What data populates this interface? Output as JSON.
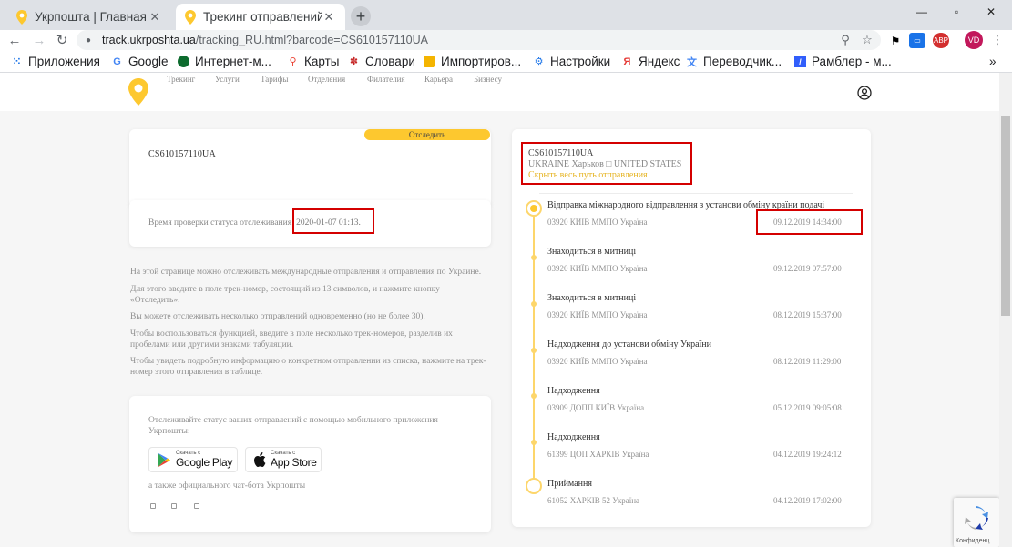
{
  "browser": {
    "tabs": [
      {
        "title": "Укрпошта | Главная п",
        "active": false
      },
      {
        "title": "Трекинг отправлений",
        "active": true
      }
    ],
    "url_host": "track.ukrposhta.ua",
    "url_path": "/tracking_RU.html?barcode=CS610157110UA",
    "avatar_initials": "VD",
    "bookmarks": [
      {
        "label": "Приложения",
        "icon": "apps-grid-icon",
        "color": "#1a73e8"
      },
      {
        "label": "Google",
        "icon": "google-icon",
        "color": "#4285f4"
      },
      {
        "label": "Интернет-м...",
        "icon": "shop-icon",
        "color": "#0d6b2e"
      },
      {
        "label": "Карты",
        "icon": "maps-pin-icon",
        "color": "#ea4335"
      },
      {
        "label": "Словари",
        "icon": "dictionary-icon",
        "color": "#c62828"
      },
      {
        "label": "Импортиров...",
        "icon": "folder-icon",
        "color": "#f4b400"
      },
      {
        "label": "Настройки",
        "icon": "gear-icon",
        "color": "#1a73e8"
      },
      {
        "label": "Яндекс",
        "icon": "yandex-icon",
        "color": "#e53935"
      },
      {
        "label": "Переводчик...",
        "icon": "translate-icon",
        "color": "#4285f4"
      },
      {
        "label": "Рамблер - м...",
        "icon": "rambler-icon",
        "color": "#315efb"
      }
    ],
    "more_bookmarks": "»"
  },
  "site": {
    "menu": [
      "Трекинг",
      "Услуги",
      "Тарифы",
      "Отделения",
      "Филателия",
      "Карьера",
      "Бизнесу"
    ],
    "accent_color": "#fdc82f"
  },
  "tracking": {
    "barcode": "CS610157110UA",
    "button_label": "Отследить",
    "time_label": "Время проверки статуса отслеживания:",
    "time_value": "2020-01-07 01:13."
  },
  "info": [
    "На этой странице можно отслеживать международные отправления и отправления по Украине.",
    "Для этого введите в поле трек-номер, состоящий из 13 символов, и нажмите кнопку «Отследить».",
    "Вы можете отслеживать несколько отправлений одновременно (но не более 30).",
    "Чтобы воспользоваться функцией, введите в поле несколько трек-номеров, разделив их пробелами или другими знаками табуляции.",
    "Чтобы увидеть подробную информацию о конкретном отправлении из списка, нажмите на трек-номер этого отправления в таблице."
  ],
  "app": {
    "text": "Отслеживайте статус ваших отправлений с помощью мобильного приложения Укрпошты:",
    "google_small": "Скачать с",
    "google_big": "Google Play",
    "apple_small": "Скачать с",
    "apple_big": "App Store",
    "bot_text": "а также официального чат-бота Укрпошты"
  },
  "shipment": {
    "barcode": "CS610157110UA",
    "route": "UKRAINE Харьков □ UNITED STATES",
    "hide_link": "Скрыть весь путь отправления"
  },
  "events": [
    {
      "title": "Відправка міжнародного відправлення з установи обміну країни подачі",
      "location": "03920 КИЇВ ММПО Україна",
      "date": "09.12.2019 14:34:00"
    },
    {
      "title": "Знаходиться в митниці",
      "location": "03920 КИЇВ ММПО Україна",
      "date": "09.12.2019 07:57:00"
    },
    {
      "title": "Знаходиться в митниці",
      "location": "03920 КИЇВ ММПО Україна",
      "date": "08.12.2019 15:37:00"
    },
    {
      "title": "Надходження до установи обміну України",
      "location": "03920 КИЇВ ММПО Україна",
      "date": "08.12.2019 11:29:00"
    },
    {
      "title": "Надходження",
      "location": "03909 ДОПП КИЇВ Україна",
      "date": "05.12.2019 09:05:08"
    },
    {
      "title": "Надходження",
      "location": "61399 ЦОП ХАРКІВ Україна",
      "date": "04.12.2019 19:24:12"
    },
    {
      "title": "Приймання",
      "location": "61052 ХАРКІВ 52 Україна",
      "date": "04.12.2019 17:02:00"
    }
  ],
  "recaptcha_label": "Конфиденц."
}
